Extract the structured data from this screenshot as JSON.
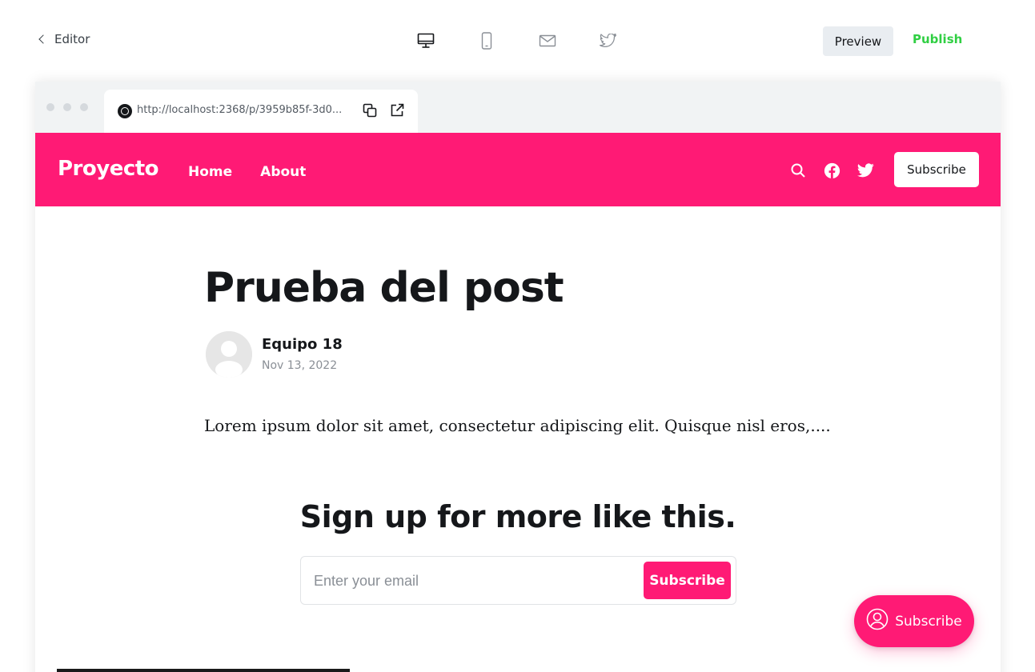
{
  "topbar": {
    "back_label": "Editor",
    "device_icons": [
      "desktop-icon",
      "mobile-icon",
      "email-icon",
      "twitter-icon"
    ],
    "preview_label": "Preview",
    "publish_label": "Publish"
  },
  "browser": {
    "url": "http://localhost:2368/p/3959b85f-3d0..."
  },
  "site": {
    "brand_color": "#ff1a75",
    "logo": "Proyecto",
    "nav": [
      "Home",
      "About"
    ],
    "subscribe_label": "Subscribe"
  },
  "post": {
    "title": "Prueba del post",
    "author": "Equipo 18",
    "date": "Nov 13, 2022",
    "excerpt": "Lorem ipsum dolor sit amet, consectetur adipiscing elit. Quisque nisl eros,...."
  },
  "signup": {
    "title": "Sign up for more like this.",
    "email_placeholder": "Enter your email",
    "button_label": "Subscribe"
  },
  "portal": {
    "label": "Subscribe"
  }
}
